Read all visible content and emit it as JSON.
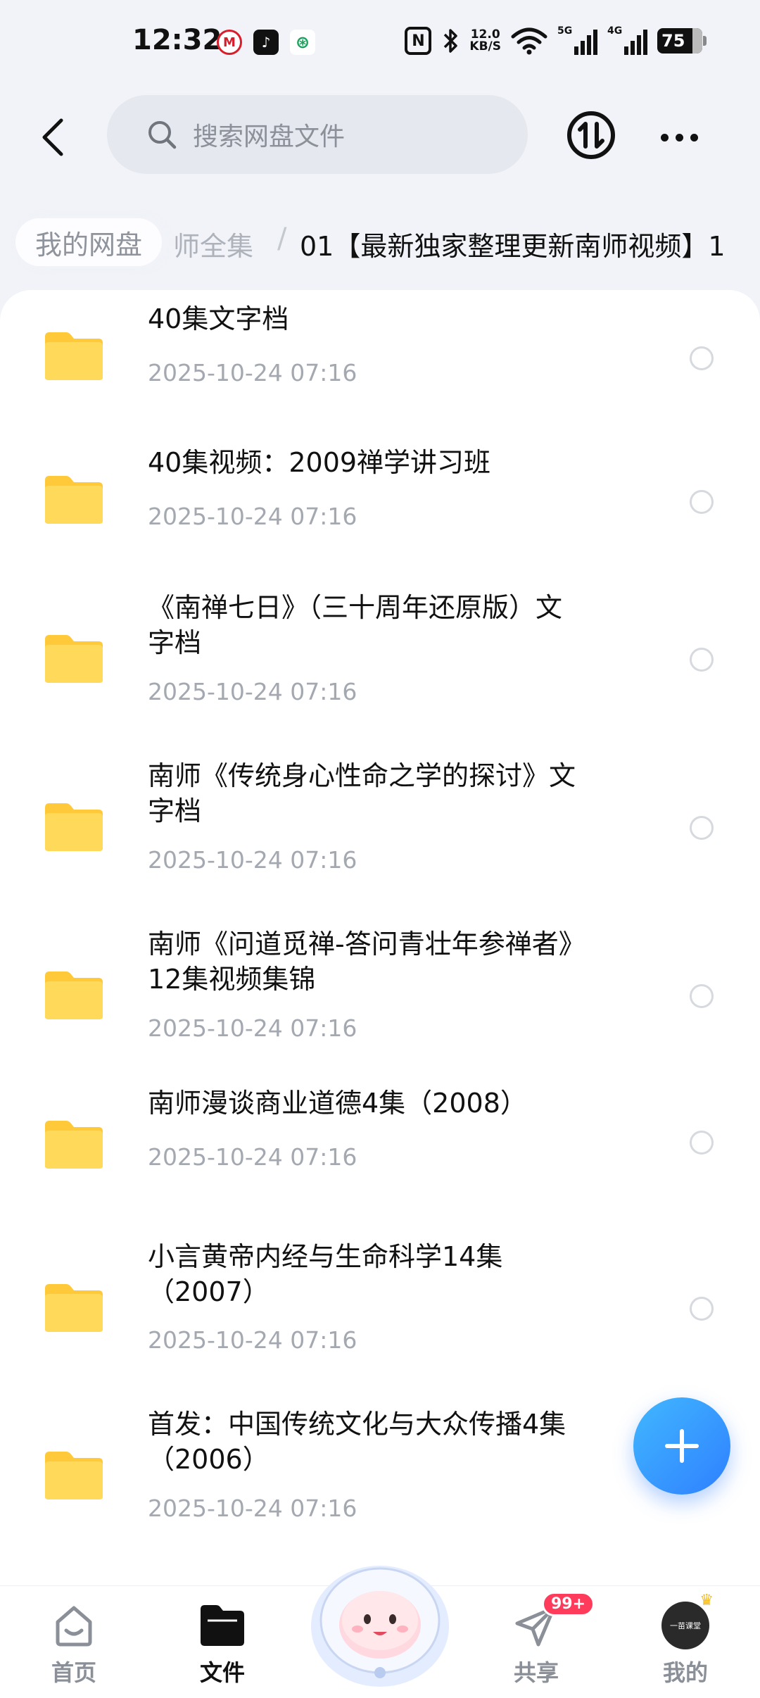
{
  "status_bar": {
    "time": "12:32",
    "notification_icons": [
      {
        "name": "metro-app-icon",
        "glyph": "M"
      },
      {
        "name": "tiktok-icon",
        "glyph": "♪"
      },
      {
        "name": "china-mobile-icon",
        "glyph": "⊛"
      }
    ],
    "nfc_label": "N",
    "net_speed_value": "12.0",
    "net_speed_unit": "KB/S",
    "signal1_tag": "5G",
    "signal2_tag": "4G",
    "battery": "75"
  },
  "top_bar": {
    "search_placeholder": "搜索网盘文件",
    "transfer_icon": "transfer-icon",
    "more_icon": "more-icon",
    "back_icon": "back-arrow-icon"
  },
  "breadcrumb": {
    "root": "我的网盘",
    "middle": "师全集",
    "separator": "/",
    "current": "01【最新独家整理更新南师视频】1"
  },
  "files": [
    {
      "name_lines": [
        "40集文字档"
      ],
      "date": "2025-10-24  07:16"
    },
    {
      "name_lines": [
        "40集视频：2009禅学讲习班"
      ],
      "date": "2025-10-24  07:16"
    },
    {
      "name_lines": [
        "《南禅七日》（三十周年还原版）文",
        "字档"
      ],
      "date": "2025-10-24  07:16"
    },
    {
      "name_lines": [
        "南师《传统身心性命之学的探讨》文",
        "字档"
      ],
      "date": "2025-10-24  07:16"
    },
    {
      "name_lines": [
        "南师《问道觅禅-答问青壮年参禅者》",
        "12集视频集锦"
      ],
      "date": "2025-10-24  07:16"
    },
    {
      "name_lines": [
        "南师漫谈商业道德4集（2008）"
      ],
      "date": "2025-10-24  07:16"
    },
    {
      "name_lines": [
        "小言黄帝内经与生命科学14集",
        "（2007）"
      ],
      "date": "2025-10-24  07:16"
    },
    {
      "name_lines": [
        "首发：中国传统文化与大众传播4集",
        "（2006）"
      ],
      "date": "2025-10-24  07:16"
    }
  ],
  "fab": {
    "icon": "plus-icon"
  },
  "bottom_nav": {
    "home": "首页",
    "files": "文件",
    "share": "共享",
    "share_badge": "99+",
    "mine": "我的",
    "avatar_text": "一苗课堂"
  },
  "colors": {
    "folder": "#FFD54A",
    "accent": "#2F80FF",
    "badge": "#FF3B5C"
  }
}
